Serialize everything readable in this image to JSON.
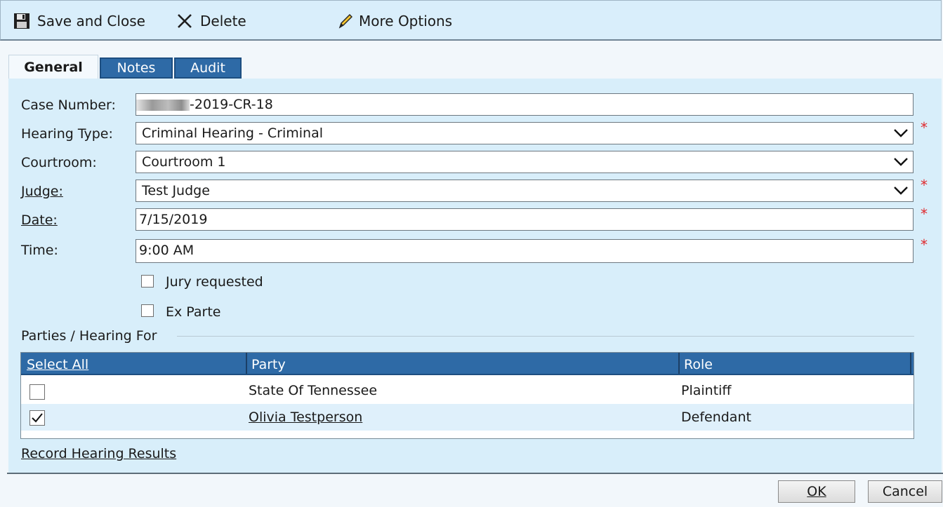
{
  "toolbar": {
    "save_close": "Save and Close",
    "delete": "Delete",
    "more_options": "More Options"
  },
  "tabs": [
    {
      "label": "General",
      "active": true
    },
    {
      "label": "Notes",
      "active": false
    },
    {
      "label": "Audit",
      "active": false
    }
  ],
  "form": {
    "case_number": {
      "label": "Case Number:",
      "value": "-2019-CR-18"
    },
    "hearing_type": {
      "label": "Hearing Type:",
      "value": "Criminal Hearing - Criminal",
      "required": true
    },
    "courtroom": {
      "label": "Courtroom:",
      "value": "Courtroom 1"
    },
    "judge": {
      "label": "Judge:",
      "value": "Test Judge",
      "required": true
    },
    "date": {
      "label": "Date:",
      "value": "7/15/2019",
      "required": true
    },
    "time": {
      "label": "Time:",
      "value": "9:00 AM",
      "required": true
    },
    "required_marker": "*",
    "jury_requested": {
      "label": "Jury requested",
      "checked": false
    },
    "ex_parte": {
      "label": "Ex Parte",
      "checked": false
    }
  },
  "parties": {
    "title": "Parties / Hearing For",
    "columns": [
      "Select All",
      "Party",
      "Role"
    ],
    "rows": [
      {
        "checked": false,
        "party": "State Of Tennessee",
        "role": "Plaintiff",
        "link": false
      },
      {
        "checked": true,
        "party": "Olivia Testperson",
        "role": "Defendant",
        "link": true
      }
    ]
  },
  "record_results": "Record Hearing Results",
  "buttons": {
    "ok": "OK",
    "cancel": "Cancel"
  },
  "colors": {
    "accent": "#2e6aa6",
    "required": "#e0282c",
    "panel": "#d8eefa"
  }
}
